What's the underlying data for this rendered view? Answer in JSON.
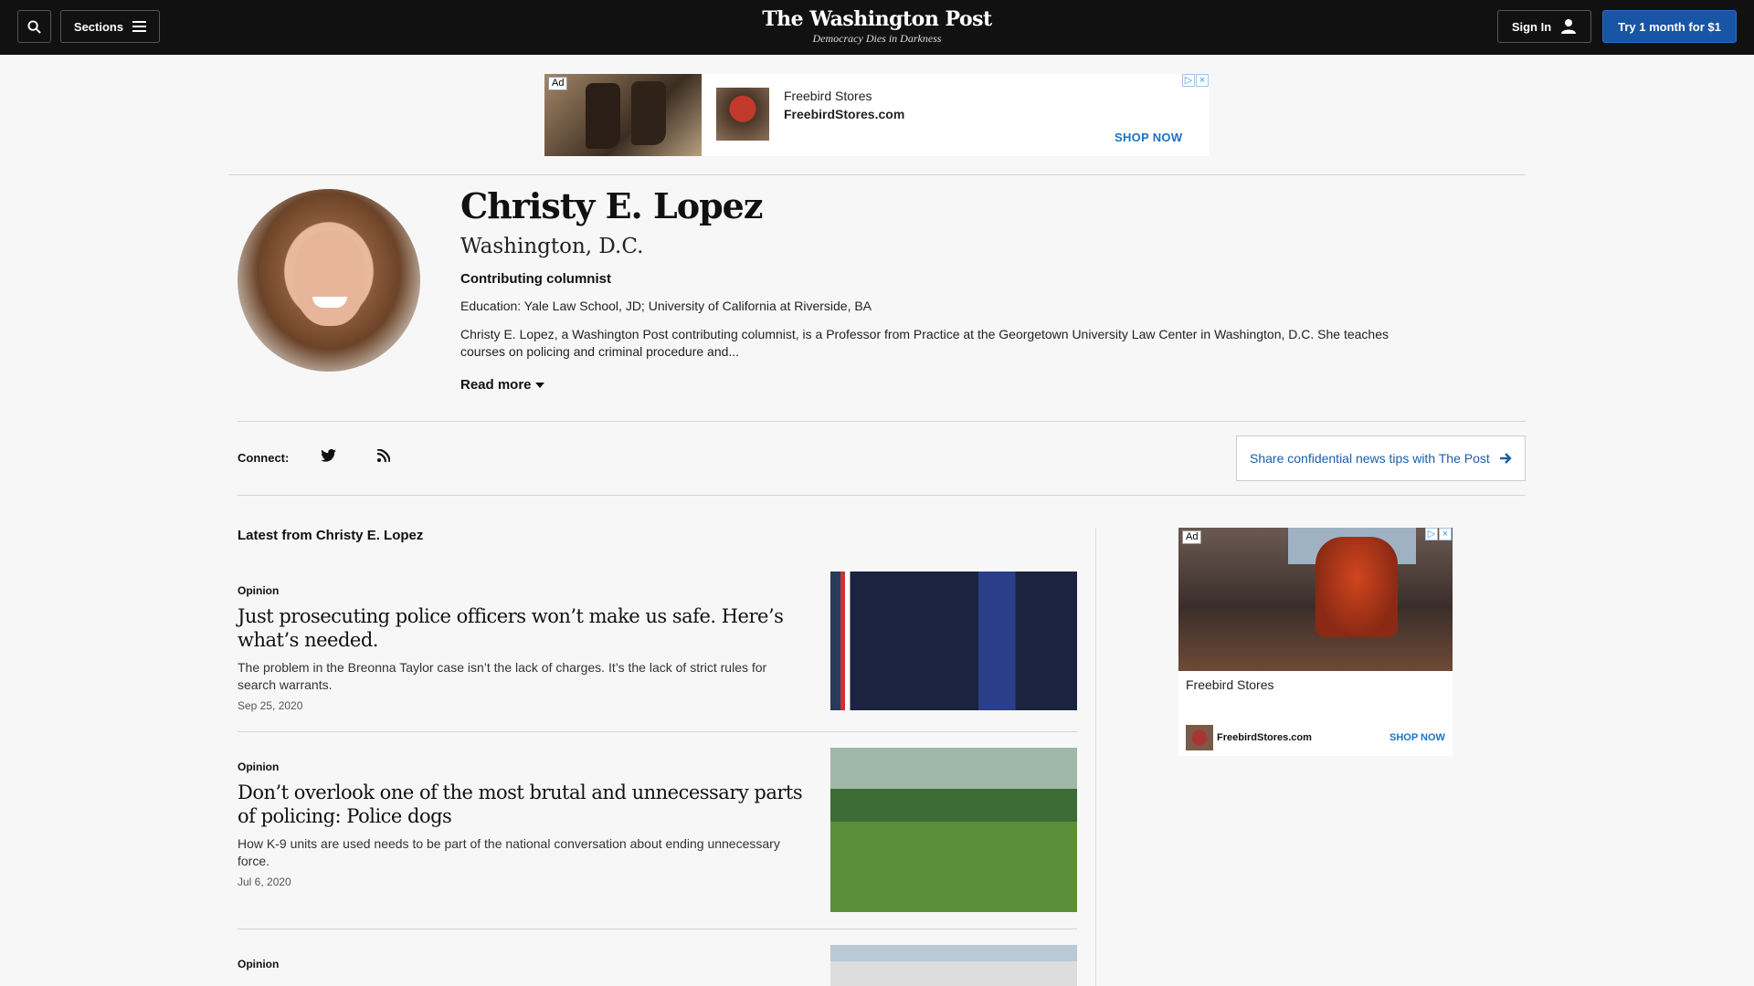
{
  "header": {
    "search_icon": "search-icon",
    "sections_label": "Sections",
    "logo": "The Washington Post",
    "tagline": "Democracy Dies in Darkness",
    "signin_label": "Sign In",
    "try_label": "Try 1 month for $1"
  },
  "ad_top": {
    "badge": "Ad",
    "name": "Freebird Stores",
    "url": "FreebirdStores.com",
    "cta": "SHOP NOW"
  },
  "profile": {
    "name": "Christy E. Lopez",
    "location": "Washington, D.C.",
    "role": "Contributing columnist",
    "education": "Education: Yale Law School, JD; University of California at Riverside, BA",
    "bio": "Christy E. Lopez, a Washington Post contributing columnist, is a Professor from Practice at the Georgetown University Law Center in Washington, D.C. She teaches courses on policing and criminal procedure and...",
    "read_more": "Read more"
  },
  "connect": {
    "label": "Connect:",
    "tips": "Share confidential news tips with The Post"
  },
  "latest": {
    "heading": "Latest from Christy E. Lopez",
    "articles": [
      {
        "kicker": "Opinion",
        "headline": "Just prosecuting police officers won’t make us safe. Here’s what’s needed.",
        "summary": "The problem in the Breonna Taylor case isn’t the lack of charges. It’s the lack of strict rules for search warrants.",
        "date": "Sep 25, 2020"
      },
      {
        "kicker": "Opinion",
        "headline": "Don’t overlook one of the most brutal and unnecessary parts of policing: Police dogs",
        "summary": "How K-9 units are used needs to be part of the national conversation about ending unnecessary force.",
        "date": "Jul 6, 2020"
      },
      {
        "kicker": "Opinion",
        "headline": "",
        "summary": "",
        "date": ""
      }
    ]
  },
  "ad_side": {
    "badge": "Ad",
    "name": "Freebird Stores",
    "url": "FreebirdStores.com",
    "cta": "SHOP NOW"
  },
  "colors": {
    "topbar": "#111111",
    "accent": "#1955a5",
    "link": "#1a5fa8",
    "background": "#f7f7f7"
  }
}
